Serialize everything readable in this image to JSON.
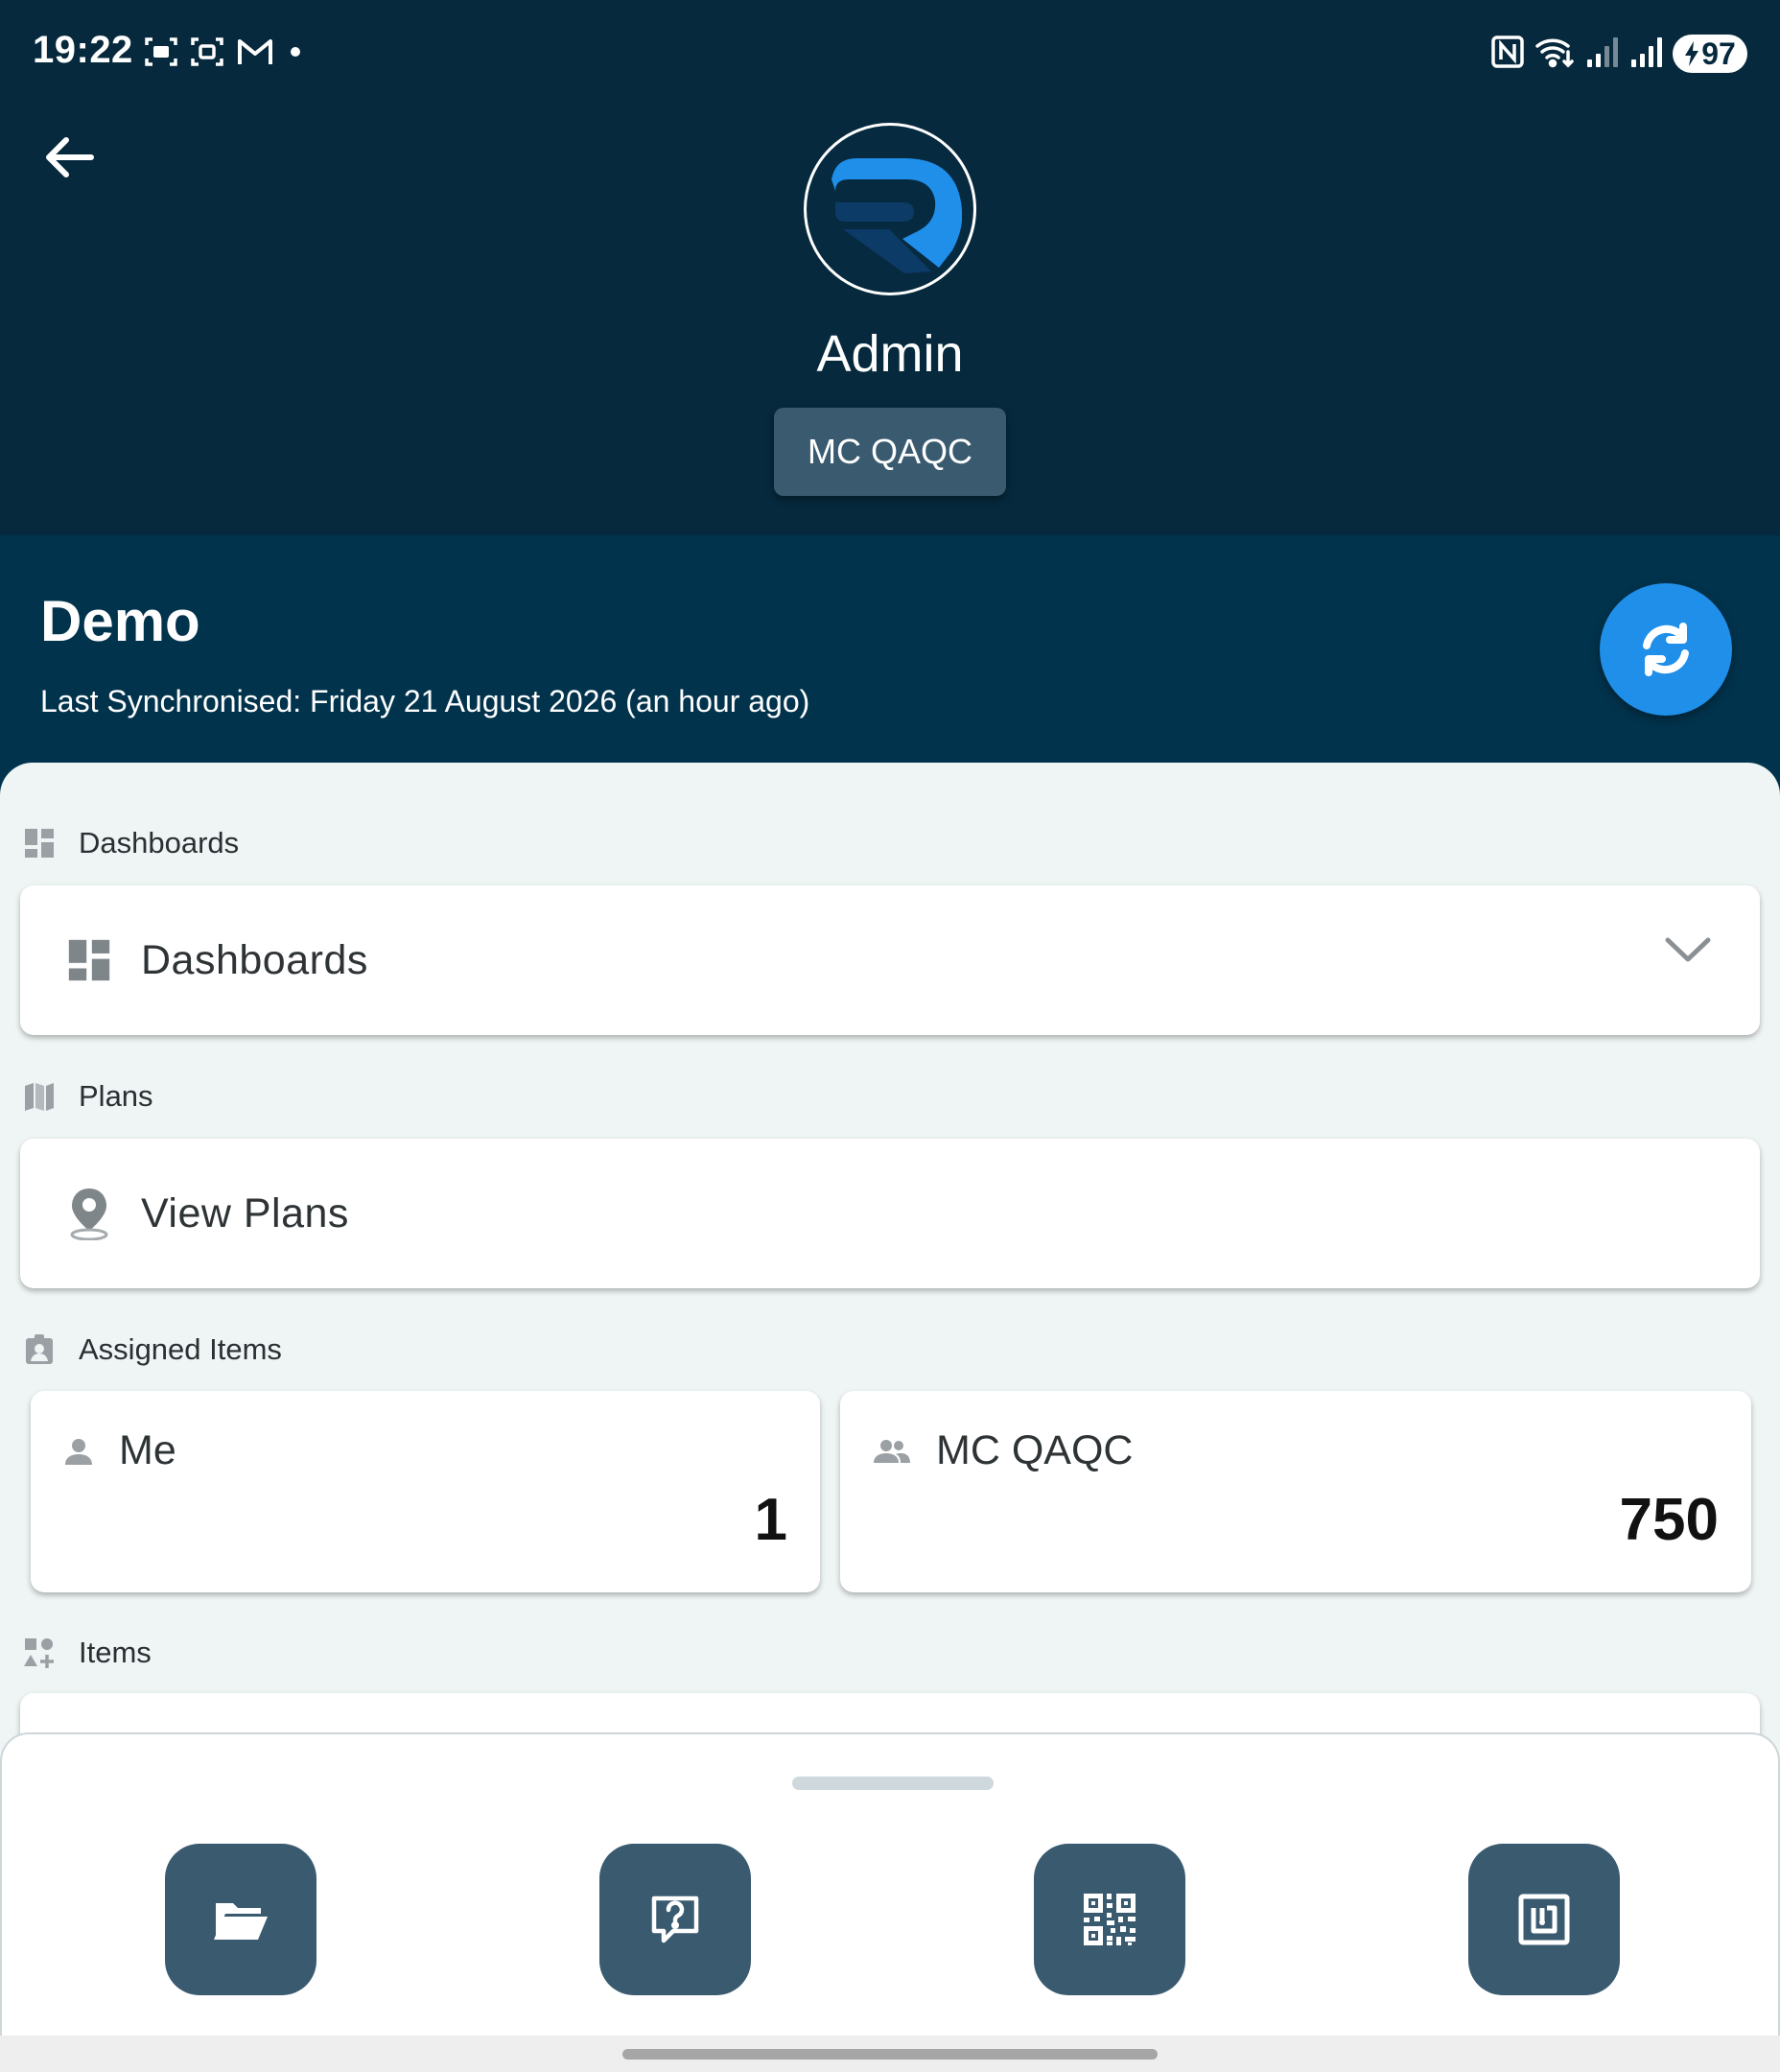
{
  "status_bar": {
    "time": "19:22",
    "battery": "97",
    "left_icons": [
      "screenshot-icon",
      "screen-record-icon",
      "gmail-icon",
      "notification-dot-icon"
    ],
    "right_icons": [
      "nfc-icon",
      "wifi-icon",
      "signal-1-icon",
      "signal-2-icon",
      "battery-icon"
    ]
  },
  "header": {
    "back_icon": "arrow-left-icon",
    "avatar_icon": "r-logo-icon",
    "profile_name": "Admin",
    "team_button": "MC QAQC"
  },
  "project": {
    "title": "Demo",
    "last_sync": "Last Synchronised: Friday 21 August 2026 (an hour ago)",
    "sync_icon": "sync-icon"
  },
  "sections": {
    "dashboards": {
      "label": "Dashboards",
      "card_label": "Dashboards",
      "card_icon": "dashboard-icon",
      "chevron_icon": "chevron-down-icon"
    },
    "plans": {
      "label": "Plans",
      "card_label": "View Plans",
      "card_icon": "location-pin-icon"
    },
    "assigned_items": {
      "label": "Assigned Items",
      "me": {
        "label": "Me",
        "count": "1",
        "icon": "person-icon"
      },
      "team": {
        "label": "MC QAQC",
        "count": "750",
        "icon": "group-icon"
      }
    },
    "items": {
      "label": "Items"
    }
  },
  "bottom_sheet": {
    "actions": [
      {
        "name": "open-folder",
        "icon": "folder-open-icon"
      },
      {
        "name": "help",
        "icon": "help-chat-icon"
      },
      {
        "name": "qr-scan",
        "icon": "qr-code-icon"
      },
      {
        "name": "nfc-scan",
        "icon": "nfc-tag-icon"
      }
    ]
  },
  "colors": {
    "header_bg": "#06293d",
    "project_bg": "#02334d",
    "accent": "#1f8fea",
    "button_bg": "#3a5a70",
    "content_bg": "#eef5f4"
  }
}
